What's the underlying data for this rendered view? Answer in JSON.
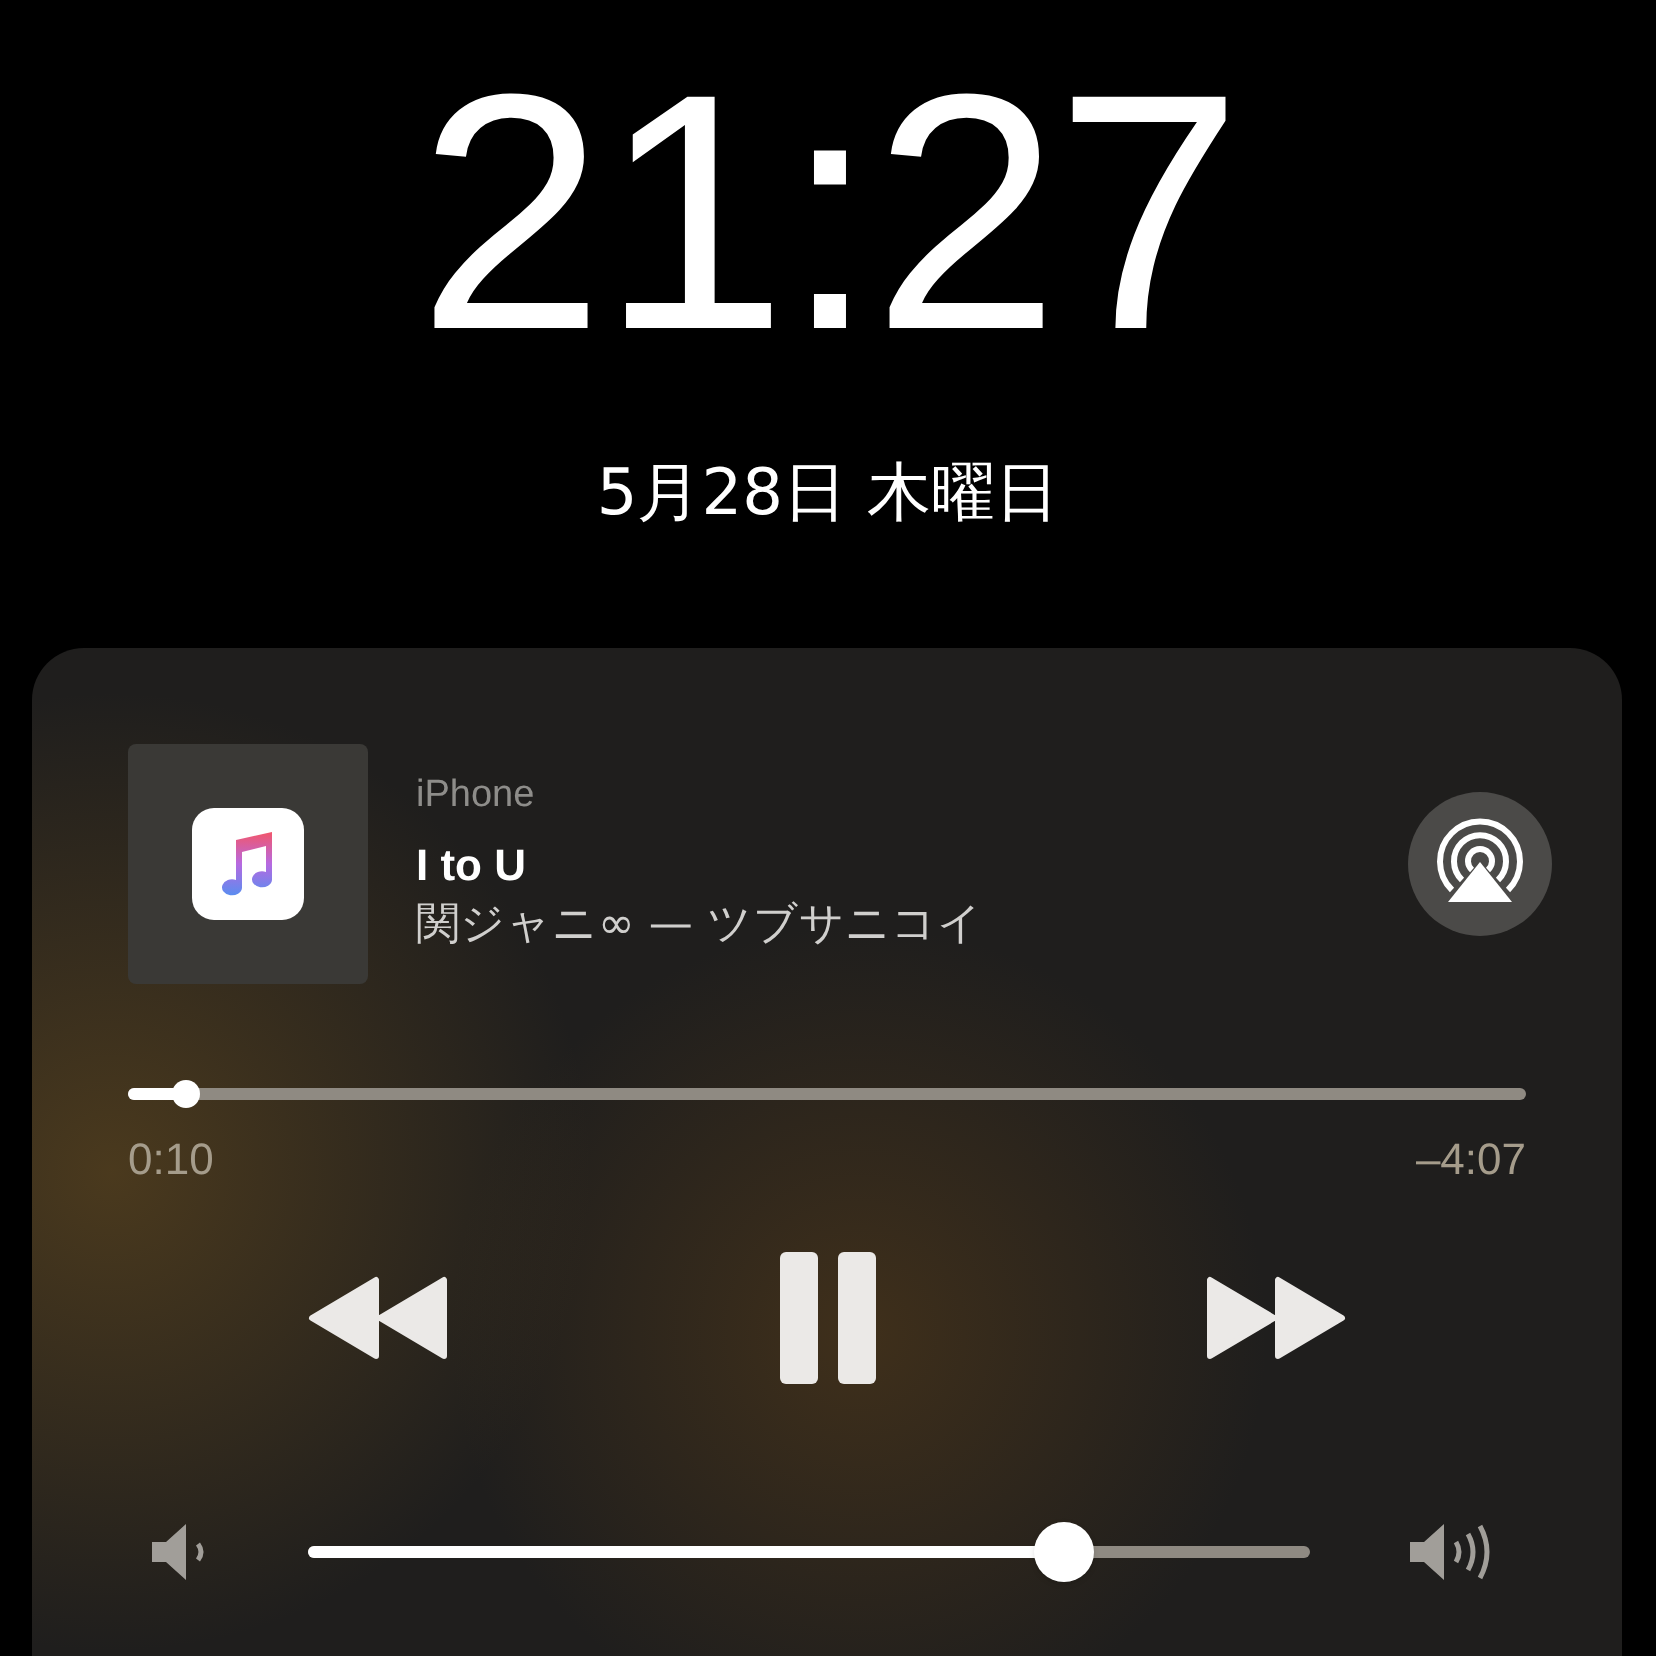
{
  "lock_screen": {
    "time": "21:27",
    "date": "5月28日 木曜日"
  },
  "now_playing": {
    "source": "iPhone",
    "title": "I to U",
    "subtitle": "関ジャニ∞ — ツブサニコイ",
    "progress": {
      "level": 0.041,
      "elapsed": "0:10",
      "remaining": "–4:07"
    },
    "volume": {
      "level": 0.755
    }
  }
}
